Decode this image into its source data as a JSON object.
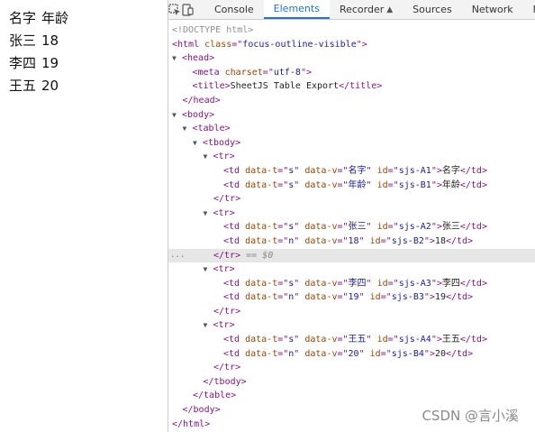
{
  "page_table": {
    "rows": [
      [
        "名字",
        "年龄"
      ],
      [
        "张三",
        "18"
      ],
      [
        "李四",
        "19"
      ],
      [
        "王五",
        "20"
      ]
    ]
  },
  "devtools": {
    "tabs": [
      "Console",
      "Elements",
      "Recorder",
      "Sources",
      "Network",
      "M"
    ],
    "active_tab": "Elements",
    "doctype": "<!DOCTYPE html>",
    "html_open": {
      "tag": "html",
      "attr": "class",
      "value": "focus-outline-visible"
    },
    "head_tag": "head",
    "meta": {
      "tag": "meta",
      "attr": "charset",
      "value": "utf-8"
    },
    "title": {
      "tag": "title",
      "text": "SheetJS Table Export"
    },
    "body_tag": "body",
    "table_tag": "table",
    "tbody_tag": "tbody",
    "tr_tag": "tr",
    "td_tag": "td",
    "attr_names": [
      "data-t",
      "data-v",
      "id"
    ],
    "cells": [
      [
        {
          "t": "s",
          "v": "名字",
          "id": "sjs-A1",
          "text": "名字"
        },
        {
          "t": "s",
          "v": "年龄",
          "id": "sjs-B1",
          "text": "年龄"
        }
      ],
      [
        {
          "t": "s",
          "v": "张三",
          "id": "sjs-A2",
          "text": "张三"
        },
        {
          "t": "n",
          "v": "18",
          "id": "sjs-B2",
          "text": "18"
        }
      ],
      [
        {
          "t": "s",
          "v": "李四",
          "id": "sjs-A3",
          "text": "李四"
        },
        {
          "t": "n",
          "v": "19",
          "id": "sjs-B3",
          "text": "19"
        }
      ],
      [
        {
          "t": "s",
          "v": "王五",
          "id": "sjs-A4",
          "text": "王五"
        },
        {
          "t": "n",
          "v": "20",
          "id": "sjs-B4",
          "text": "20"
        }
      ]
    ],
    "selected_suffix": "== $0",
    "ellipsis": "..."
  },
  "watermark": "CSDN @言小溪",
  "colors": {
    "tag": "#881280",
    "attr": "#994500",
    "value": "#1a1aa6",
    "active_tab": "#1a73e8",
    "selected_row": "#e6e6e6"
  },
  "icons": [
    "inspect-element-icon",
    "device-toggle-icon",
    "flask-icon",
    "expand-triangle-icon"
  ]
}
